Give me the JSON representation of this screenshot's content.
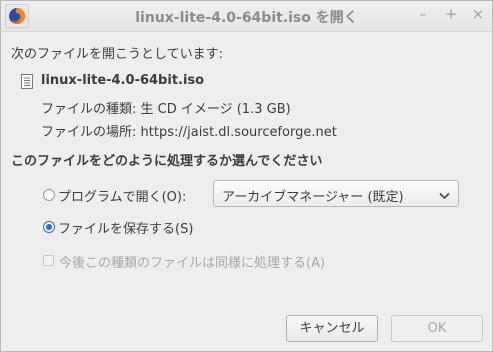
{
  "window": {
    "title": "linux-lite-4.0-64bit.iso を開く",
    "controls": {
      "minimize": "–",
      "maximize": "+",
      "close": "×"
    }
  },
  "dialog": {
    "prompt": "次のファイルを開こうとしています:",
    "file_name": "linux-lite-4.0-64bit.iso",
    "file_type": "ファイルの種類: 生 CD イメージ (1.3 GB)",
    "file_source": "ファイルの場所: https://jaist.dl.sourceforge.net",
    "question": "このファイルをどのように処理するか選んでください",
    "open_with_label": "プログラムで開く(O):",
    "open_with_selected": "アーカイブマネージャー (既定)",
    "save_file_label": "ファイルを保存する(S)",
    "remember_label": "今後この種類のファイルは同様に処理する(A)",
    "selected_option": "save_file"
  },
  "buttons": {
    "cancel": "キャンセル",
    "ok": "OK"
  },
  "icons": {
    "app": "firefox-icon",
    "file": "document-icon",
    "dropdown": "chevron-down-icon"
  },
  "colors": {
    "accent": "#2d6ad0",
    "window_bg": "#eeeeee",
    "disabled_text": "#a6a6a6"
  }
}
